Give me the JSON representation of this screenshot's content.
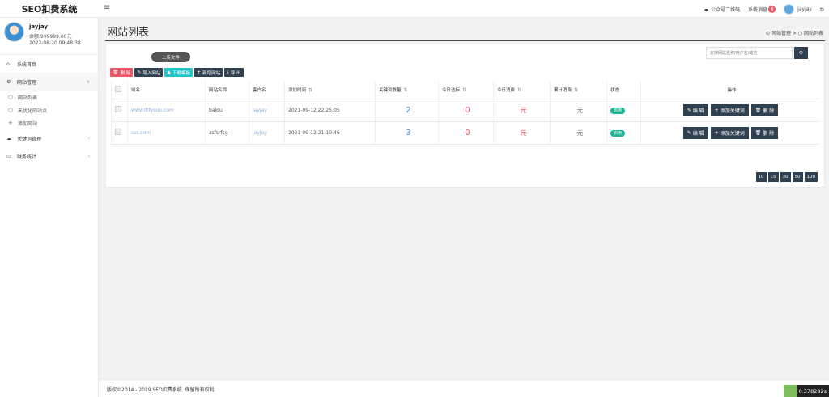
{
  "app": {
    "title": "SEO扣费系统"
  },
  "topbar": {
    "qr_label": "公众号二维码",
    "messages_label": "系统消息",
    "messages_count": "0",
    "user": "jayjay"
  },
  "profile": {
    "name": "jayjay",
    "balance": "余额:999999.00元",
    "time": "2022-08-20 09:48:38"
  },
  "sidebar": {
    "home": "系统首页",
    "site_mgmt": "网站管理",
    "site_list": "网站列表",
    "unoptimized": "未优化的站点",
    "add_site": "添加网站",
    "keyword_mgmt": "关键词管理",
    "finance": "财务统计"
  },
  "page": {
    "title": "网站列表",
    "breadcrumb_1": "网站管理",
    "breadcrumb_sep": ">",
    "breadcrumb_2": "网站列表"
  },
  "search": {
    "placeholder": "支持网站名称/用户名/域名"
  },
  "upload_label": "上传文件",
  "toolbar": {
    "delete": "删 除",
    "import": "导入网站",
    "download": "下载模板",
    "add": "新增网站",
    "export": "导 出"
  },
  "table": {
    "headers": [
      "域名",
      "网站名称",
      "客户名",
      "添加时间",
      "关键词数量",
      "今日达标",
      "今日消费",
      "累计消费",
      "状态",
      "操作"
    ],
    "rows": [
      {
        "domain": "www.lfifyoux.com",
        "name": "baidu",
        "customer": "jayjay",
        "time": "2021-09-12 22:25:05",
        "keywords": "2",
        "today_ok": "0",
        "today_cost": "元",
        "total_cost": "元",
        "status": "启用"
      },
      {
        "domain": "sss.com",
        "name": "asfsrfsg",
        "customer": "jayjay",
        "time": "2021-09-12 21:10:46",
        "keywords": "3",
        "today_ok": "0",
        "today_cost": "元",
        "total_cost": "元",
        "status": "启用"
      }
    ],
    "actions": {
      "edit": "编 辑",
      "add_kw": "添加关键词",
      "delete": "删 除"
    }
  },
  "pager": [
    "10",
    "15",
    "30",
    "50",
    "100"
  ],
  "footer": {
    "copyright": "版权©2014 - 2019 SEO扣费系统. 保留所有权利."
  },
  "timer": {
    "value": "0.378282s"
  }
}
